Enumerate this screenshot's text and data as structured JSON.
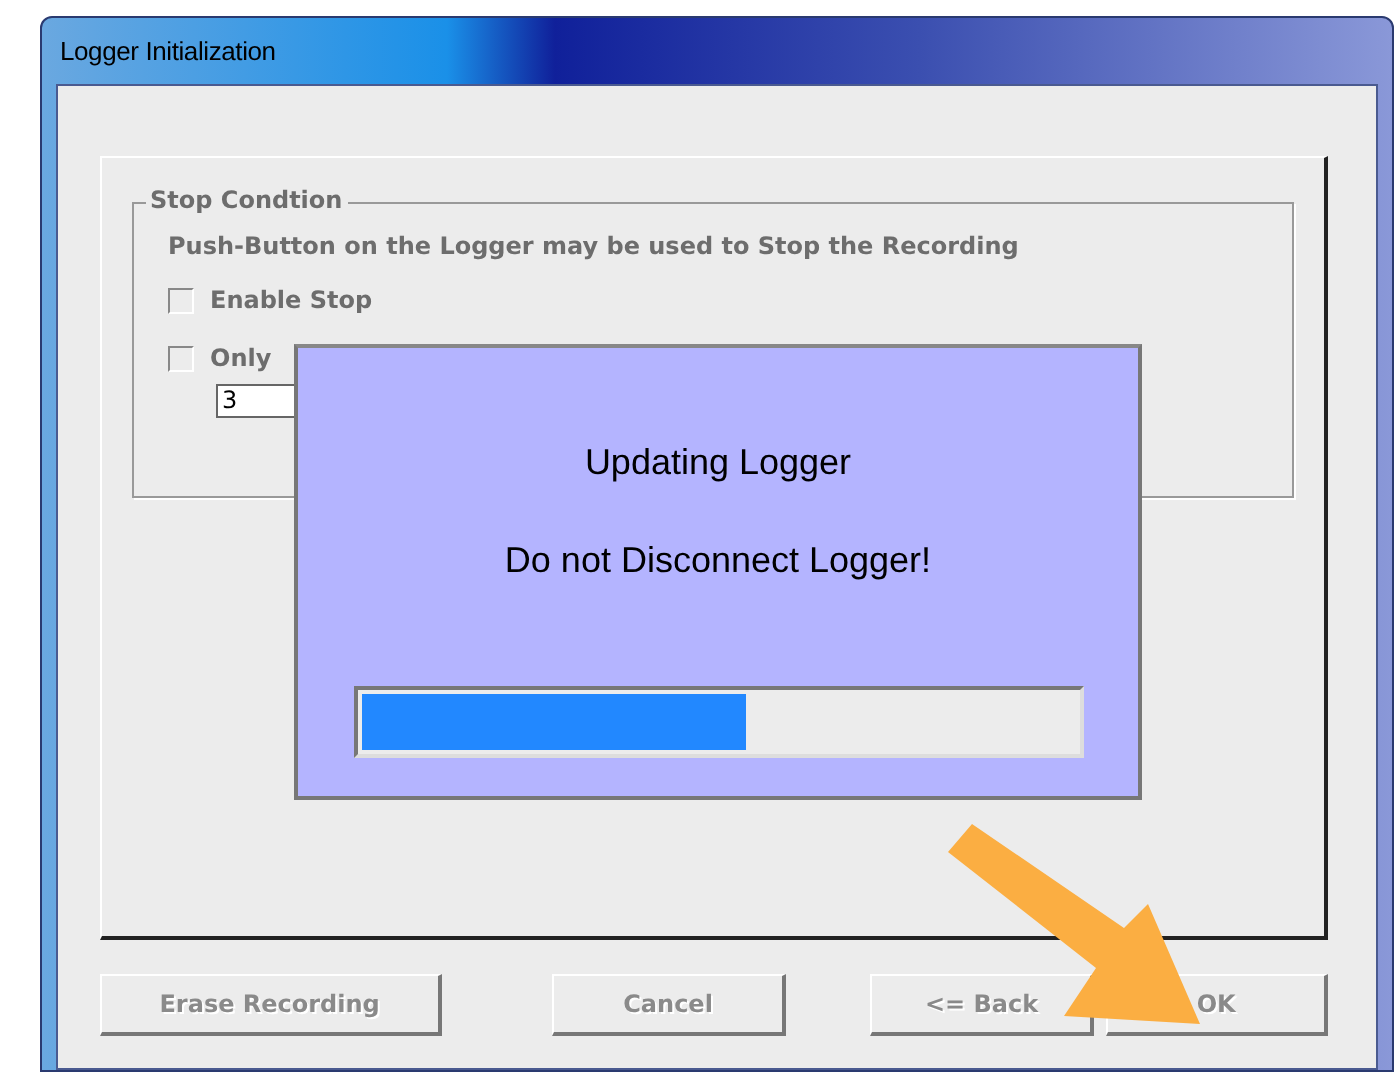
{
  "window": {
    "title": "Logger Initialization"
  },
  "group": {
    "title": "Stop Condtion",
    "description": "Push-Button on the Logger may be used to Stop the Recording",
    "checkboxes": [
      {
        "label": "Enable Stop",
        "checked": false
      },
      {
        "label": "Only",
        "checked": false
      }
    ],
    "field": {
      "value": "3"
    }
  },
  "buttons": [
    {
      "label": "Erase Recording",
      "disabled": true
    },
    {
      "label": "Cancel",
      "disabled": true
    },
    {
      "label": "<= Back",
      "disabled": true
    },
    {
      "label": "OK",
      "disabled": true
    }
  ],
  "progress_dialog": {
    "title": "Updating Logger",
    "message": "Do not Disconnect Logger!",
    "level": 0.54
  }
}
